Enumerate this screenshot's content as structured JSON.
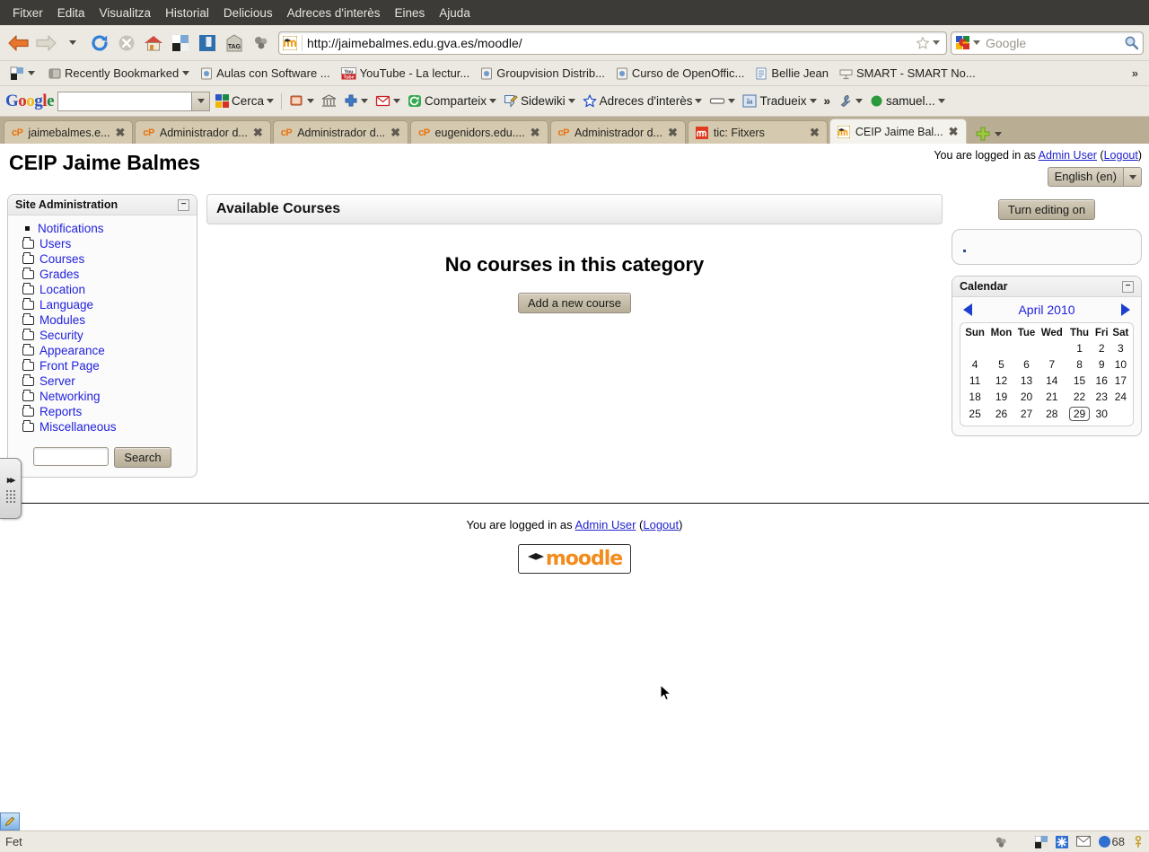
{
  "browser": {
    "menu": [
      "Fitxer",
      "Edita",
      "Visualitza",
      "Historial",
      "Delicious",
      "Adreces d'interès",
      "Eines",
      "Ajuda"
    ],
    "url": "http://jaimebalmes.edu.gva.es/moodle/",
    "search_placeholder": "Google",
    "search_engine": "Google",
    "status_text": "Fet",
    "tray_count": "68"
  },
  "bookmarks": [
    {
      "label": "Recently Bookmarked",
      "icon": "bookmark-folder-icon",
      "caret": true
    },
    {
      "label": "Aulas con Software ...",
      "icon": "page-icon",
      "caret": false
    },
    {
      "label": "YouTube - La lectur...",
      "icon": "youtube-icon",
      "caret": false
    },
    {
      "label": "Groupvision Distrib...",
      "icon": "page-icon",
      "caret": false
    },
    {
      "label": "Curso de OpenOffic...",
      "icon": "page-icon",
      "caret": false
    },
    {
      "label": "Bellie Jean",
      "icon": "document-icon",
      "caret": false
    },
    {
      "label": "SMART - SMART No...",
      "icon": "smart-icon",
      "caret": false
    }
  ],
  "google_toolbar": {
    "logo": "Google",
    "search_value": "",
    "items": [
      {
        "label": "Cerca",
        "icon": "google-search-icon",
        "caret": true
      },
      {
        "label": "",
        "icon": "bookmarks-star-icon",
        "caret": true
      },
      {
        "label": "",
        "icon": "bank-icon",
        "caret": false
      },
      {
        "label": "",
        "icon": "plus-icon",
        "caret": true
      },
      {
        "label": "",
        "icon": "mail-icon",
        "caret": true
      },
      {
        "label": "Comparteix",
        "icon": "share-icon",
        "caret": true
      },
      {
        "label": "Sidewiki",
        "icon": "sidewiki-icon",
        "caret": true
      },
      {
        "label": "Adreces d'interès",
        "icon": "star-icon",
        "caret": true
      },
      {
        "label": "",
        "icon": "highlight-icon",
        "caret": true
      },
      {
        "label": "Tradueix",
        "icon": "translate-icon",
        "caret": true
      },
      {
        "label": "»",
        "icon": "overflow-icon",
        "caret": false
      },
      {
        "label": "",
        "icon": "wrench-icon",
        "caret": true
      },
      {
        "label": "samuel...",
        "icon": "account-icon",
        "caret": true
      }
    ]
  },
  "tabs": [
    {
      "label": "jaimebalmes.e...",
      "favicon": "cpanel-icon",
      "active": false
    },
    {
      "label": "Administrador d...",
      "favicon": "cpanel-icon",
      "active": false
    },
    {
      "label": "Administrador d...",
      "favicon": "cpanel-icon",
      "active": false
    },
    {
      "label": "eugenidors.edu....",
      "favicon": "cpanel-icon",
      "active": false
    },
    {
      "label": "Administrador d...",
      "favicon": "cpanel-icon",
      "active": false
    },
    {
      "label": "tic: Fitxers",
      "favicon": "moodle-icon",
      "active": false
    },
    {
      "label": "CEIP Jaime Bal...",
      "favicon": "moodle-icon",
      "active": true
    }
  ],
  "page": {
    "site_title": "CEIP Jaime Balmes",
    "login_prefix": "You are logged in as",
    "login_user": "Admin User",
    "logout_label": "Logout",
    "language": "English (en)"
  },
  "sidebar": {
    "title": "Site Administration",
    "items": [
      {
        "label": "Notifications",
        "icon": "bullet-icon"
      },
      {
        "label": "Users",
        "icon": "folder-icon"
      },
      {
        "label": "Courses",
        "icon": "folder-icon"
      },
      {
        "label": "Grades",
        "icon": "folder-icon"
      },
      {
        "label": "Location",
        "icon": "folder-icon"
      },
      {
        "label": "Language",
        "icon": "folder-icon"
      },
      {
        "label": "Modules",
        "icon": "folder-icon"
      },
      {
        "label": "Security",
        "icon": "folder-icon"
      },
      {
        "label": "Appearance",
        "icon": "folder-icon"
      },
      {
        "label": "Front Page",
        "icon": "folder-icon"
      },
      {
        "label": "Server",
        "icon": "folder-icon"
      },
      {
        "label": "Networking",
        "icon": "folder-icon"
      },
      {
        "label": "Reports",
        "icon": "folder-icon"
      },
      {
        "label": "Miscellaneous",
        "icon": "folder-icon"
      }
    ],
    "search_value": "",
    "search_button": "Search"
  },
  "main": {
    "heading": "Available Courses",
    "empty_message": "No courses in this category",
    "add_course_button": "Add a new course"
  },
  "right": {
    "edit_button": "Turn editing on",
    "calendar": {
      "title": "Calendar",
      "prev": "◀",
      "next": "▶",
      "month": "April 2010",
      "weekdays": [
        "Sun",
        "Mon",
        "Tue",
        "Wed",
        "Thu",
        "Fri",
        "Sat"
      ],
      "weeks": [
        [
          "",
          "",
          "",
          "",
          "1",
          "2",
          "3"
        ],
        [
          "4",
          "5",
          "6",
          "7",
          "8",
          "9",
          "10"
        ],
        [
          "11",
          "12",
          "13",
          "14",
          "15",
          "16",
          "17"
        ],
        [
          "18",
          "19",
          "20",
          "21",
          "22",
          "23",
          "24"
        ],
        [
          "25",
          "26",
          "27",
          "28",
          "29",
          "30",
          ""
        ]
      ],
      "today": "29"
    }
  },
  "footer": {
    "login_prefix": "You are logged in as",
    "login_user": "Admin User",
    "logout_label": "Logout",
    "logo_text": "moodle"
  },
  "colors": {
    "link": "#2222dd",
    "weekend": "#aa0000",
    "chrome": "#ece9e2",
    "tabstrip": "#b9ae94",
    "moodle_orange": "#f28c1c"
  }
}
